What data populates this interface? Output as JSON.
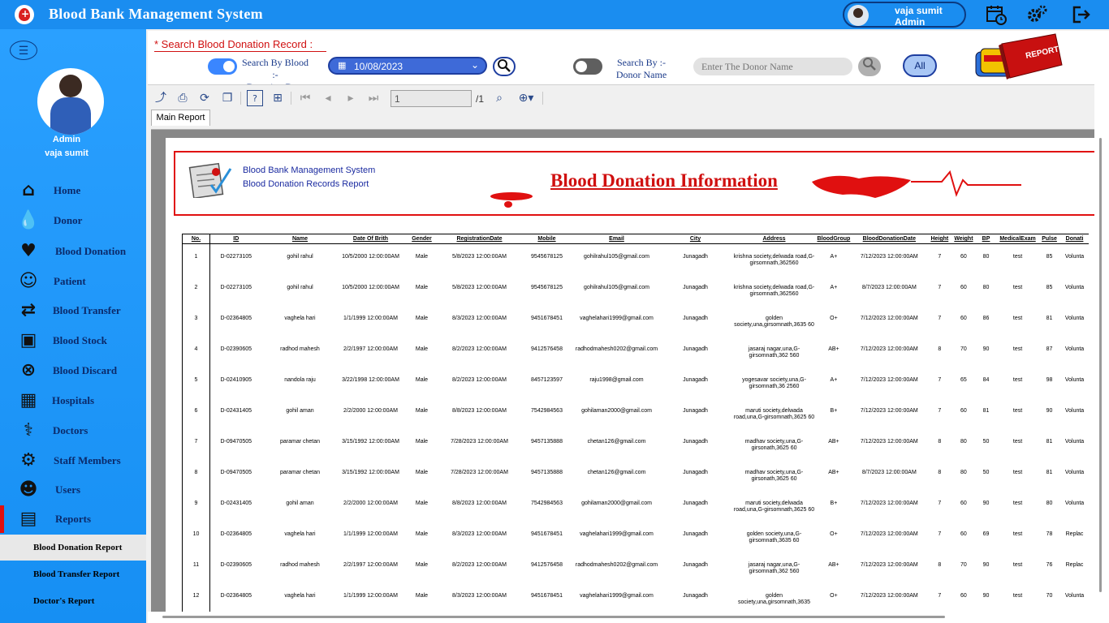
{
  "app": {
    "title": "Blood Bank Management System"
  },
  "header": {
    "user_name": "vaja sumit",
    "user_role": "Admin",
    "icons": [
      "calendar-clock-icon",
      "settings-gears-icon",
      "logout-icon"
    ]
  },
  "sidebar": {
    "role": "Admin",
    "user": "vaja sumit",
    "items": [
      {
        "label": "Home",
        "icon": "home-icon"
      },
      {
        "label": "Donor",
        "icon": "donor-icon"
      },
      {
        "label": "Blood Donation",
        "icon": "blood-donation-icon"
      },
      {
        "label": "Patient",
        "icon": "patient-icon"
      },
      {
        "label": "Blood Transfer",
        "icon": "blood-transfer-icon"
      },
      {
        "label": "Blood Stock",
        "icon": "blood-stock-icon"
      },
      {
        "label": "Blood Discard",
        "icon": "blood-discard-icon"
      },
      {
        "label": "Hospitals",
        "icon": "hospital-icon"
      },
      {
        "label": "Doctors",
        "icon": "doctor-icon"
      },
      {
        "label": "Staff Members",
        "icon": "staff-icon"
      },
      {
        "label": "Users",
        "icon": "users-icon"
      },
      {
        "label": "Reports",
        "icon": "reports-icon"
      }
    ],
    "sub_items": [
      "Blood Donation Report",
      "Blood Transfer Report",
      "Doctor's  Report"
    ]
  },
  "search": {
    "title": "*  Search Blood Donation Record  :",
    "by_date_label_1": "Search By Blood  :-",
    "by_date_label_2": "Donation Date",
    "date_value": "10/08/2023",
    "by_donor_label_1": "Search By  :-",
    "by_donor_label_2": "Donor Name",
    "donor_placeholder": "Enter The Donor Name",
    "all_label": "All",
    "report_logo_text": "REPORT",
    "date_toggle_on": true,
    "donor_toggle_on": false
  },
  "viewer": {
    "page_value": "1",
    "page_total": "/1",
    "tab_label": "Main Report"
  },
  "report": {
    "system_name": "Blood Bank Management System",
    "subtitle": "Blood Donation Records Report",
    "title": "Blood Donation Information",
    "columns": [
      "No.",
      "ID",
      "Name",
      "Date Of Brith",
      "Gender",
      "RegistrationDate",
      "Mobile",
      "Email",
      "City",
      "Address",
      "BloodGroup",
      "BloodDonationDate",
      "Height",
      "Weight",
      "BP",
      "MedicalExam",
      "Pulse",
      "Donati"
    ],
    "rows": [
      [
        "1",
        "D-02273105",
        "gohil rahul",
        "10/5/2000  12:00:00AM",
        "Male",
        "5/8/2023  12:00:00AM",
        "9545678125",
        "gohilrahul105@gmail.com",
        "Junagadh",
        "krishna society,delwada road,G-girsomnath,362560",
        "A+",
        "7/12/2023  12:00:00AM",
        "7",
        "60",
        "80",
        "test",
        "85",
        "Volunta"
      ],
      [
        "2",
        "D-02273105",
        "gohil rahul",
        "10/5/2000  12:00:00AM",
        "Male",
        "5/8/2023  12:00:00AM",
        "9545678125",
        "gohilrahul105@gmail.com",
        "Junagadh",
        "krishna society,delwada road,G-girsomnath,362560",
        "A+",
        "8/7/2023  12:00:00AM",
        "7",
        "60",
        "80",
        "test",
        "85",
        "Volunta"
      ],
      [
        "3",
        "D-02364805",
        "vaghela hari",
        "1/1/1999  12:00:00AM",
        "Male",
        "8/3/2023  12:00:00AM",
        "9451678451",
        "vaghelahari1999@gmail.com",
        "Junagadh",
        "golden society,una,girsomnath,3635 60",
        "O+",
        "7/12/2023  12:00:00AM",
        "7",
        "60",
        "86",
        "test",
        "81",
        "Volunta"
      ],
      [
        "4",
        "D-02390605",
        "radhod mahesh",
        "2/2/1997  12:00:00AM",
        "Male",
        "8/2/2023  12:00:00AM",
        "9412576458",
        "radhodmahesh0202@gmail.com",
        "Junagadh",
        "jasaraj nagar,una,G-girsomnath,362 560",
        "AB+",
        "7/12/2023  12:00:00AM",
        "8",
        "70",
        "90",
        "test",
        "87",
        "Volunta"
      ],
      [
        "5",
        "D-02410905",
        "nandola raju",
        "3/22/1998  12:00:00AM",
        "Male",
        "8/2/2023  12:00:00AM",
        "8457123597",
        "raju1998@gmail.com",
        "Junagadh",
        "yogesavar society,una,G-girsomnath,36 2560",
        "A+",
        "7/12/2023  12:00:00AM",
        "7",
        "65",
        "84",
        "test",
        "98",
        "Volunta"
      ],
      [
        "6",
        "D-02431405",
        "gohil aman",
        "2/2/2000  12:00:00AM",
        "Male",
        "8/8/2023  12:00:00AM",
        "7542984563",
        "gohilaman2000@gmail.com",
        "Junagadh",
        "maruti society,delwada road,una,G-girsomnath,3625 60",
        "B+",
        "7/12/2023  12:00:00AM",
        "7",
        "60",
        "81",
        "test",
        "90",
        "Volunta"
      ],
      [
        "7",
        "D-09470505",
        "paramar chetan",
        "3/15/1992  12:00:00AM",
        "Male",
        "7/28/2023  12:00:00AM",
        "9457135888",
        "chetan126@gmail.com",
        "Junagadh",
        "madhav society,una,G-girsonath,3625 60",
        "AB+",
        "7/12/2023  12:00:00AM",
        "8",
        "80",
        "50",
        "test",
        "81",
        "Volunta"
      ],
      [
        "8",
        "D-09470505",
        "paramar chetan",
        "3/15/1992  12:00:00AM",
        "Male",
        "7/28/2023  12:00:00AM",
        "9457135888",
        "chetan126@gmail.com",
        "Junagadh",
        "madhav society,una,G-girsonath,3625 60",
        "AB+",
        "8/7/2023  12:00:00AM",
        "8",
        "80",
        "50",
        "test",
        "81",
        "Volunta"
      ],
      [
        "9",
        "D-02431405",
        "gohil aman",
        "2/2/2000  12:00:00AM",
        "Male",
        "8/8/2023  12:00:00AM",
        "7542984563",
        "gohilaman2000@gmail.com",
        "Junagadh",
        "maruti society,delwada road,una,G-girsomnath,3625 60",
        "B+",
        "7/12/2023  12:00:00AM",
        "7",
        "60",
        "90",
        "test",
        "80",
        "Volunta"
      ],
      [
        "10",
        "D-02364805",
        "vaghela hari",
        "1/1/1999  12:00:00AM",
        "Male",
        "8/3/2023  12:00:00AM",
        "9451678451",
        "vaghelahari1999@gmail.com",
        "Junagadh",
        "golden society,una,G-girsomnath,3635 60",
        "O+",
        "7/12/2023  12:00:00AM",
        "7",
        "60",
        "69",
        "test",
        "78",
        "Replac"
      ],
      [
        "11",
        "D-02390605",
        "radhod mahesh",
        "2/2/1997  12:00:00AM",
        "Male",
        "8/2/2023  12:00:00AM",
        "9412576458",
        "radhodmahesh0202@gmail.com",
        "Junagadh",
        "jasaraj nagar,una,G-girsomnath,362 560",
        "AB+",
        "7/12/2023  12:00:00AM",
        "8",
        "70",
        "90",
        "test",
        "76",
        "Replac"
      ],
      [
        "12",
        "D-02364805",
        "vaghela hari",
        "1/1/1999  12:00:00AM",
        "Male",
        "8/3/2023  12:00:00AM",
        "9451678451",
        "vaghelahari1999@gmail.com",
        "Junagadh",
        "golden society,una,girsomnath,3635",
        "O+",
        "7/12/2023  12:00:00AM",
        "7",
        "60",
        "90",
        "test",
        "70",
        "Volunta"
      ]
    ]
  },
  "colors": {
    "brand": "#1a8df0",
    "accent_red": "#d01010",
    "nav_text": "#0b2a6a"
  }
}
